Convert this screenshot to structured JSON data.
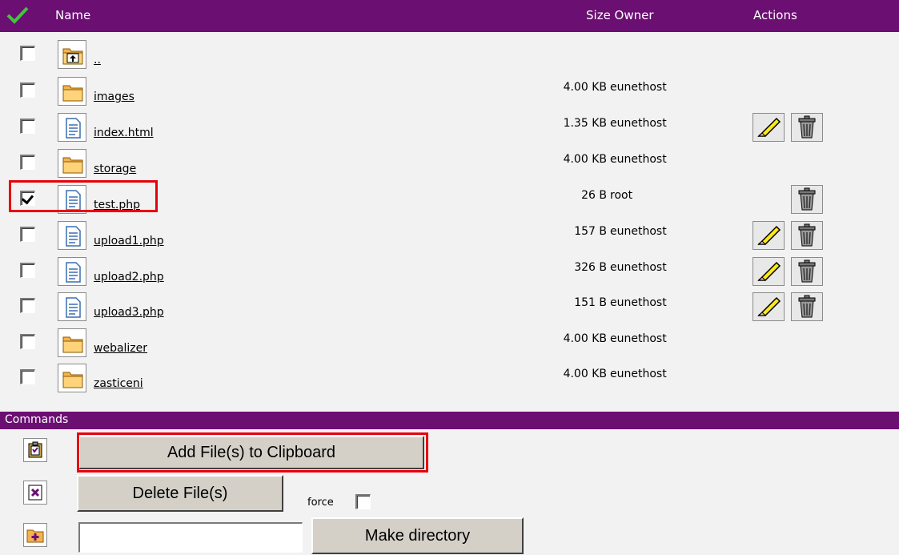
{
  "header": {
    "name_label": "Name",
    "size_owner_label": "Size Owner",
    "actions_label": "Actions",
    "bg_color": "#6b0f73"
  },
  "files": [
    {
      "name": "..",
      "type": "parent-folder",
      "size": "",
      "owner": "",
      "checked": false
    },
    {
      "name": "images",
      "type": "folder",
      "size": "4.00 KB",
      "owner": "eunethost",
      "checked": false
    },
    {
      "name": "index.html",
      "type": "file",
      "size": "1.35 KB",
      "owner": "eunethost",
      "checked": false
    },
    {
      "name": "storage",
      "type": "folder",
      "size": "4.00 KB",
      "owner": "eunethost",
      "checked": false
    },
    {
      "name": "test.php",
      "type": "file",
      "size": "26 B",
      "owner": "root",
      "checked": true
    },
    {
      "name": "upload1.php",
      "type": "file",
      "size": "157 B",
      "owner": "eunethost",
      "checked": false
    },
    {
      "name": "upload2.php",
      "type": "file",
      "size": "326 B",
      "owner": "eunethost",
      "checked": false
    },
    {
      "name": "upload3.php",
      "type": "file",
      "size": "151 B",
      "owner": "eunethost",
      "checked": false
    },
    {
      "name": "webalizer",
      "type": "folder",
      "size": "4.00 KB",
      "owner": "eunethost",
      "checked": false
    },
    {
      "name": "zasticeni",
      "type": "folder",
      "size": "4.00 KB",
      "owner": "eunethost",
      "checked": false
    }
  ],
  "commands": {
    "title": "Commands",
    "add_clipboard_label": "Add File(s) to Clipboard",
    "delete_label": "Delete File(s)",
    "force_label": "force",
    "make_dir_label": "Make directory",
    "new_dir_value": ""
  },
  "colors": {
    "highlight": "#e8000b",
    "button_face": "#d4d0c8"
  }
}
